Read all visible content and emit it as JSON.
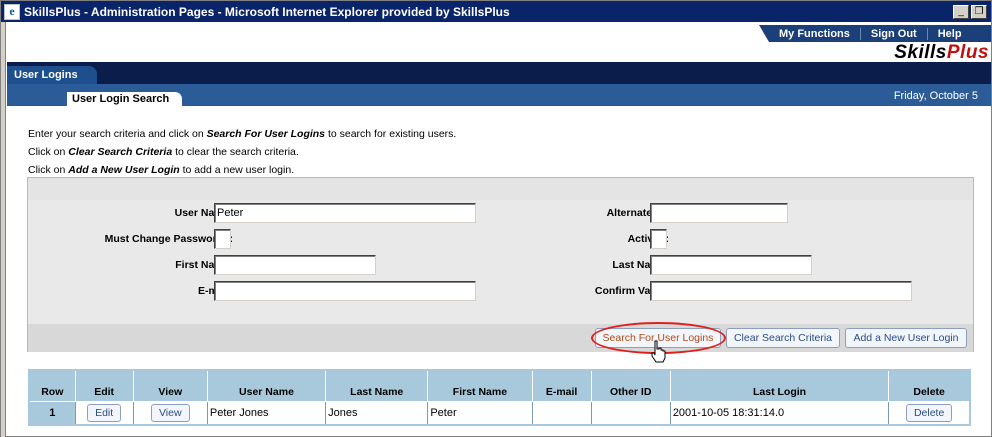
{
  "window": {
    "title": "SkillsPlus - Administration Pages - Microsoft Internet Explorer provided by SkillsPlus",
    "minimize_glyph": "_",
    "restore_glyph": "❐"
  },
  "topnav": {
    "items": [
      "My Functions",
      "Sign Out",
      "Help"
    ]
  },
  "logo": {
    "part1": "Skills",
    "part2": "Plus"
  },
  "tabs": {
    "main": "User Logins",
    "sub": "User Login Search",
    "date": "Friday, October 5"
  },
  "instructions": {
    "line1_pre": "Enter your search criteria and click on ",
    "line1_bold": "Search For User Logins",
    "line1_post": " to search for existing users.",
    "line2_pre": "Click on ",
    "line2_bold": "Clear Search Criteria",
    "line2_post": " to clear the search criteria.",
    "line3_pre": "Click on ",
    "line3_bold": "Add a New User Login",
    "line3_post": " to add a new user login."
  },
  "form": {
    "user_name_label": "User Name:",
    "user_name_value": "Peter",
    "must_change_label": "Must Change Password?:",
    "must_change_value": "",
    "first_name_label": "First Name:",
    "first_name_value": "",
    "email_label": "E-mail:",
    "email_value": "",
    "alternate_id_label": "Alternate ID:",
    "alternate_id_value": "",
    "active_label": "Active?:",
    "active_value": "",
    "last_name_label": "Last Name:",
    "last_name_value": "",
    "confirm_label": "Confirm Value:",
    "confirm_value": ""
  },
  "buttons": {
    "search": "Search For User Logins",
    "clear": "Clear Search Criteria",
    "add": "Add a New User Login"
  },
  "results": {
    "headers": [
      "Row",
      "Edit",
      "View",
      "User Name",
      "Last Name",
      "First Name",
      "E-mail",
      "Other ID",
      "Last Login",
      "Delete"
    ],
    "rows": [
      {
        "row": "1",
        "edit": "Edit",
        "view": "View",
        "user_name": "Peter Jones",
        "last_name": "Jones",
        "first_name": "Peter",
        "email": "",
        "other_id": "",
        "last_login": "2001-10-05 18:31:14.0",
        "delete": "Delete"
      }
    ]
  },
  "colors": {
    "titlebar": "#0a246a",
    "nav_dark": "#0b1d4a",
    "nav_mid": "#2c5c97",
    "table_header": "#a8c8dc",
    "highlight_circle": "#e02020",
    "logo_accent": "#c01010"
  }
}
